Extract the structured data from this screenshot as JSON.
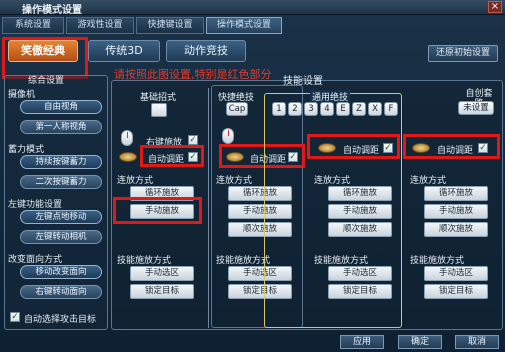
{
  "window": {
    "title": "操作模式设置",
    "close_glyph": "×"
  },
  "top_tabs": [
    "系统设置",
    "游戏性设置",
    "快捷键设置",
    "操作模式设置"
  ],
  "mode_tabs": [
    "笑傲经典",
    "传统3D",
    "动作竞技"
  ],
  "reset_label": "还原初始设置",
  "note": "请按照此图设置,特别是红色部分",
  "left_panel": {
    "title": "综合设置",
    "camera": {
      "title": "摄像机",
      "options": [
        "自由视角",
        "第一人称视角"
      ]
    },
    "charge": {
      "title": "蓄力模式",
      "options": [
        "持续按键蓄力",
        "二次按键蓄力"
      ]
    },
    "left_click": {
      "title": "左键功能设置",
      "options": [
        "左键点地移动",
        "左键转动相机"
      ]
    },
    "direction": {
      "title": "改变面向方式",
      "options": [
        "移动改变面向",
        "右键转动面向"
      ]
    },
    "auto_attack": "自动选择攻击目标"
  },
  "skill_settings_title": "技能设置",
  "basic_column": {
    "title": "基础招式",
    "right_click": "右键施放",
    "auto_adjust": "自动调距",
    "cast_mode_label": "连放方式",
    "cast_options": [
      "循环施放",
      "手动施放"
    ],
    "skill_cast_label": "技能施放方式",
    "skill_options": [
      "手动选区",
      "锁定目标"
    ]
  },
  "quick_column": {
    "title": "快捷绝技",
    "key": "Cap",
    "auto_adjust": "自动调距",
    "cast_mode_label": "连放方式",
    "cast_options": [
      "循环施放",
      "手动施放",
      "顺次施放"
    ],
    "skill_cast_label": "技能施放方式",
    "skill_options": [
      "手动选区",
      "锁定目标"
    ]
  },
  "general_column": {
    "title": "通用绝技",
    "keys": [
      "1",
      "2",
      "3",
      "4",
      "E",
      "Z",
      "X",
      "F"
    ],
    "auto_adjust": "自动调距",
    "cast_mode_label": "连放方式",
    "cast_options": [
      "循环施放",
      "手动施放",
      "顺次施放"
    ],
    "skill_cast_label": "技能施放方式",
    "skill_options": [
      "手动选区",
      "锁定目标"
    ]
  },
  "custom_column": {
    "title": "自创套路",
    "key": "未设置",
    "auto_adjust": "自动调距",
    "cast_mode_label": "连放方式",
    "cast_options": [
      "循环施放",
      "手动施放",
      "顺次施放"
    ],
    "skill_cast_label": "技能施放方式",
    "skill_options": [
      "手动选区",
      "锁定目标"
    ]
  },
  "check_glyph": "✓",
  "bottom_buttons": [
    "应用",
    "确定",
    "取消"
  ],
  "colors": {
    "highlight_red": "#e01818",
    "active_tab": "#d8692a",
    "panel_bg": "#14283a"
  }
}
